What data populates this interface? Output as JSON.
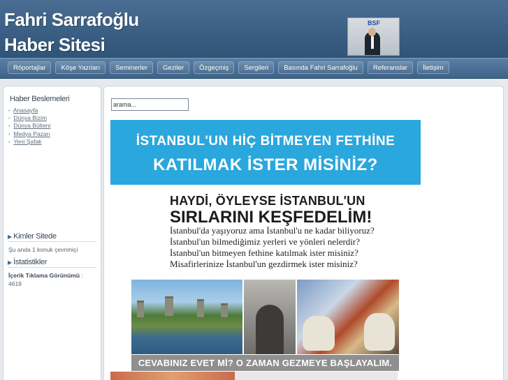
{
  "header": {
    "title_line1": "Fahri Sarrafoğlu",
    "title_line2": "Haber Sitesi",
    "photo_logo": "BSF",
    "photo_icon": "person-photo"
  },
  "nav": {
    "items": [
      "Röportajlar",
      "Köşe Yazıları",
      "Seminerler",
      "Geziler",
      "Özgeçmiş",
      "Sergileri",
      "Basında Fahri Sarrafoğlu",
      "Referanslar",
      "İletişim"
    ]
  },
  "sidebar": {
    "feeds_title": "Haber Beslemeleri",
    "feeds": [
      "Anasayfa",
      "Dünya Bizim",
      "Dünya Bülteni",
      "Medya Pazarı",
      "Yeni Şafak"
    ],
    "who_title": "Kimler Sitede",
    "who_text": "Şu anda 1 konuk çevrimiçi",
    "stats_title": "İstatistikler",
    "stats_label": "İçerik Tıklama Görünümü",
    "stats_sep": " :",
    "stats_value": "4619"
  },
  "search": {
    "value": "arama..."
  },
  "banner": {
    "line1": "İSTANBUL'UN HİÇ BİTMEYEN FETHİNE",
    "line2": "KATILMAK İSTER MİSİNİZ?",
    "color": "#2aa7dd"
  },
  "poster": {
    "headline1": "HAYDİ, ÖYLEYSE İSTANBUL'UN",
    "headline2": "SIRLARINI KEŞFEDELİM!",
    "questions": [
      "İstanbul'da yaşıyoruz ama İstanbul'u ne kadar biliyoruz?",
      "İstanbul'un bilmediğimiz yerleri ve yönleri nelerdir?",
      "İstanbul'un bitmeyen fethine katılmak ister misiniz?",
      "Misafirlerinize İstanbul'un gezdirmek ister misiniz?"
    ],
    "cta": "CEVABINIZ EVET Mİ? O ZAMAN GEZMEYE BAŞLAYALIM."
  },
  "colors": {
    "header": "#3b6085",
    "nav": "#4d7196",
    "cta": "#8f8f8f"
  }
}
